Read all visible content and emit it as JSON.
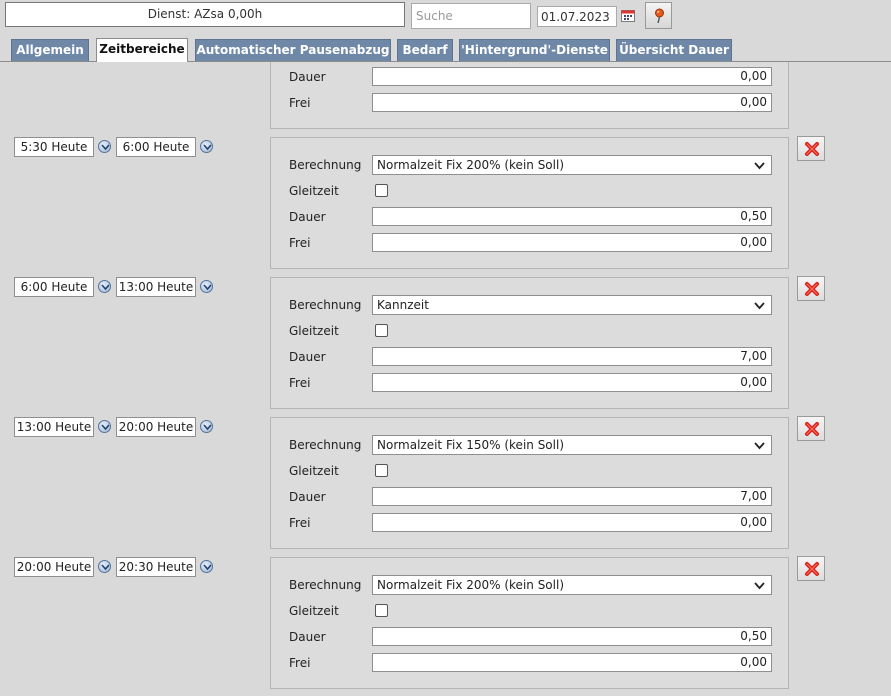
{
  "header": {
    "dienst_label": "Dienst: AZsa 0,00h",
    "search_placeholder": "Suche",
    "date_value": "01.07.2023"
  },
  "tabs": [
    {
      "label": "Allgemein",
      "active": false
    },
    {
      "label": "Zeitbereiche",
      "active": true
    },
    {
      "label": "Automatischer Pausenabzug",
      "active": false
    },
    {
      "label": "Bedarf",
      "active": false
    },
    {
      "label": "'Hintergrund'-Dienste",
      "active": false
    },
    {
      "label": "Übersicht Dauer",
      "active": false
    }
  ],
  "labels": {
    "berechnung": "Berechnung",
    "gleitzeit": "Gleitzeit",
    "dauer": "Dauer",
    "frei": "Frei"
  },
  "top_partial": {
    "dauer": "0,00",
    "frei": "0,00"
  },
  "ranges": [
    {
      "from": "5:30 Heute",
      "to": "6:00 Heute",
      "berechnung": "Normalzeit Fix 200% (kein Soll)",
      "dauer": "0,50",
      "frei": "0,00"
    },
    {
      "from": "6:00 Heute",
      "to": "13:00 Heute",
      "berechnung": "Kannzeit",
      "dauer": "7,00",
      "frei": "0,00"
    },
    {
      "from": "13:00 Heute",
      "to": "20:00 Heute",
      "berechnung": "Normalzeit Fix 150% (kein Soll)",
      "dauer": "7,00",
      "frei": "0,00"
    },
    {
      "from": "20:00 Heute",
      "to": "20:30 Heute",
      "berechnung": "Normalzeit Fix 200% (kein Soll)",
      "dauer": "0,50",
      "frei": "0,00"
    }
  ],
  "colors": {
    "tab_bg": "#6f88a8",
    "delete_red": "#d9231c"
  },
  "icons": {
    "calendar": "calendar-icon",
    "pin": "pin-icon",
    "expand": "chevron-down-icon",
    "delete": "delete-x-icon"
  }
}
